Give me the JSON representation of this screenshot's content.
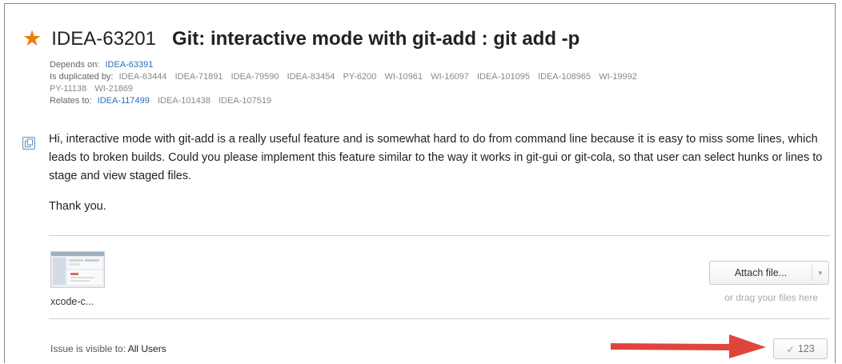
{
  "issue": {
    "id": "IDEA-63201",
    "title": "Git: interactive mode with git-add : git add -p",
    "starred": true
  },
  "links": {
    "depends_label": "Depends on:",
    "depends": [
      "IDEA-63391"
    ],
    "duplicated_label": "Is duplicated by:",
    "duplicated": [
      "IDEA-63444",
      "IDEA-71891",
      "IDEA-79590",
      "IDEA-83454",
      "PY-6200",
      "WI-10961",
      "WI-16097",
      "IDEA-101095",
      "IDEA-108965",
      "WI-19992",
      "PY-11138",
      "WI-21869"
    ],
    "relates_label": "Relates to:",
    "relates": [
      "IDEA-117499",
      "IDEA-101438",
      "IDEA-107519"
    ]
  },
  "description": {
    "paragraph1": "Hi, interactive mode with git-add is a really useful feature and is somewhat hard to do from command line because it is easy to miss some lines, which leads to broken builds. Could you please implement this feature similar to the way it works in git-gui or git-cola, so that user can select hunks or lines to stage and view staged files.",
    "paragraph2": "Thank you."
  },
  "attachments": {
    "files": [
      {
        "name": "xcode-c..."
      }
    ],
    "attach_button": "Attach file...",
    "drag_hint": "or drag your files here"
  },
  "footer": {
    "visibility_label": "Issue is visible to:",
    "visibility_value": "All Users",
    "vote_count": "123"
  },
  "colors": {
    "star": "#ef7d0b",
    "link": "#2a6ebb",
    "arrow": "#e0453b"
  }
}
